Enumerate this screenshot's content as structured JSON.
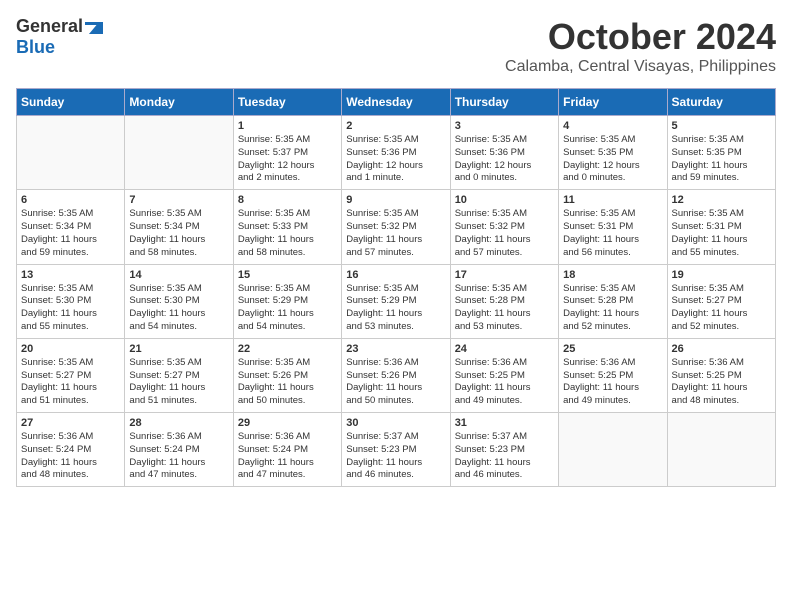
{
  "logo": {
    "line1": "General",
    "line2": "Blue"
  },
  "title": "October 2024",
  "location": "Calamba, Central Visayas, Philippines",
  "weekdays": [
    "Sunday",
    "Monday",
    "Tuesday",
    "Wednesday",
    "Thursday",
    "Friday",
    "Saturday"
  ],
  "weeks": [
    [
      {
        "day": "",
        "content": ""
      },
      {
        "day": "",
        "content": ""
      },
      {
        "day": "1",
        "content": "Sunrise: 5:35 AM\nSunset: 5:37 PM\nDaylight: 12 hours\nand 2 minutes."
      },
      {
        "day": "2",
        "content": "Sunrise: 5:35 AM\nSunset: 5:36 PM\nDaylight: 12 hours\nand 1 minute."
      },
      {
        "day": "3",
        "content": "Sunrise: 5:35 AM\nSunset: 5:36 PM\nDaylight: 12 hours\nand 0 minutes."
      },
      {
        "day": "4",
        "content": "Sunrise: 5:35 AM\nSunset: 5:35 PM\nDaylight: 12 hours\nand 0 minutes."
      },
      {
        "day": "5",
        "content": "Sunrise: 5:35 AM\nSunset: 5:35 PM\nDaylight: 11 hours\nand 59 minutes."
      }
    ],
    [
      {
        "day": "6",
        "content": "Sunrise: 5:35 AM\nSunset: 5:34 PM\nDaylight: 11 hours\nand 59 minutes."
      },
      {
        "day": "7",
        "content": "Sunrise: 5:35 AM\nSunset: 5:34 PM\nDaylight: 11 hours\nand 58 minutes."
      },
      {
        "day": "8",
        "content": "Sunrise: 5:35 AM\nSunset: 5:33 PM\nDaylight: 11 hours\nand 58 minutes."
      },
      {
        "day": "9",
        "content": "Sunrise: 5:35 AM\nSunset: 5:32 PM\nDaylight: 11 hours\nand 57 minutes."
      },
      {
        "day": "10",
        "content": "Sunrise: 5:35 AM\nSunset: 5:32 PM\nDaylight: 11 hours\nand 57 minutes."
      },
      {
        "day": "11",
        "content": "Sunrise: 5:35 AM\nSunset: 5:31 PM\nDaylight: 11 hours\nand 56 minutes."
      },
      {
        "day": "12",
        "content": "Sunrise: 5:35 AM\nSunset: 5:31 PM\nDaylight: 11 hours\nand 55 minutes."
      }
    ],
    [
      {
        "day": "13",
        "content": "Sunrise: 5:35 AM\nSunset: 5:30 PM\nDaylight: 11 hours\nand 55 minutes."
      },
      {
        "day": "14",
        "content": "Sunrise: 5:35 AM\nSunset: 5:30 PM\nDaylight: 11 hours\nand 54 minutes."
      },
      {
        "day": "15",
        "content": "Sunrise: 5:35 AM\nSunset: 5:29 PM\nDaylight: 11 hours\nand 54 minutes."
      },
      {
        "day": "16",
        "content": "Sunrise: 5:35 AM\nSunset: 5:29 PM\nDaylight: 11 hours\nand 53 minutes."
      },
      {
        "day": "17",
        "content": "Sunrise: 5:35 AM\nSunset: 5:28 PM\nDaylight: 11 hours\nand 53 minutes."
      },
      {
        "day": "18",
        "content": "Sunrise: 5:35 AM\nSunset: 5:28 PM\nDaylight: 11 hours\nand 52 minutes."
      },
      {
        "day": "19",
        "content": "Sunrise: 5:35 AM\nSunset: 5:27 PM\nDaylight: 11 hours\nand 52 minutes."
      }
    ],
    [
      {
        "day": "20",
        "content": "Sunrise: 5:35 AM\nSunset: 5:27 PM\nDaylight: 11 hours\nand 51 minutes."
      },
      {
        "day": "21",
        "content": "Sunrise: 5:35 AM\nSunset: 5:27 PM\nDaylight: 11 hours\nand 51 minutes."
      },
      {
        "day": "22",
        "content": "Sunrise: 5:35 AM\nSunset: 5:26 PM\nDaylight: 11 hours\nand 50 minutes."
      },
      {
        "day": "23",
        "content": "Sunrise: 5:36 AM\nSunset: 5:26 PM\nDaylight: 11 hours\nand 50 minutes."
      },
      {
        "day": "24",
        "content": "Sunrise: 5:36 AM\nSunset: 5:25 PM\nDaylight: 11 hours\nand 49 minutes."
      },
      {
        "day": "25",
        "content": "Sunrise: 5:36 AM\nSunset: 5:25 PM\nDaylight: 11 hours\nand 49 minutes."
      },
      {
        "day": "26",
        "content": "Sunrise: 5:36 AM\nSunset: 5:25 PM\nDaylight: 11 hours\nand 48 minutes."
      }
    ],
    [
      {
        "day": "27",
        "content": "Sunrise: 5:36 AM\nSunset: 5:24 PM\nDaylight: 11 hours\nand 48 minutes."
      },
      {
        "day": "28",
        "content": "Sunrise: 5:36 AM\nSunset: 5:24 PM\nDaylight: 11 hours\nand 47 minutes."
      },
      {
        "day": "29",
        "content": "Sunrise: 5:36 AM\nSunset: 5:24 PM\nDaylight: 11 hours\nand 47 minutes."
      },
      {
        "day": "30",
        "content": "Sunrise: 5:37 AM\nSunset: 5:23 PM\nDaylight: 11 hours\nand 46 minutes."
      },
      {
        "day": "31",
        "content": "Sunrise: 5:37 AM\nSunset: 5:23 PM\nDaylight: 11 hours\nand 46 minutes."
      },
      {
        "day": "",
        "content": ""
      },
      {
        "day": "",
        "content": ""
      }
    ]
  ]
}
